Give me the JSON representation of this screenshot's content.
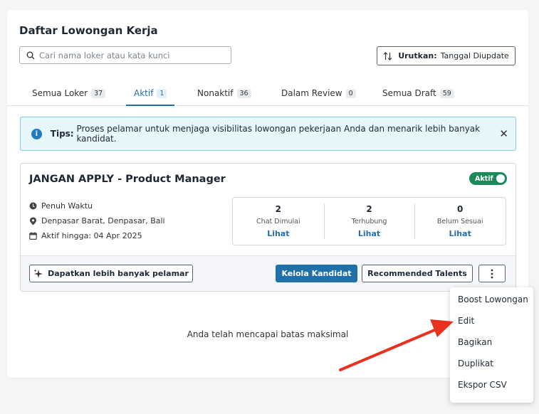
{
  "page": {
    "title": "Daftar Lowongan Kerja",
    "search_placeholder": "Cari nama loker atau kata kunci",
    "sort": {
      "label": "Urutkan:",
      "value": "Tanggal Diupdate"
    }
  },
  "tabs": [
    {
      "label": "Semua Loker",
      "count": "37"
    },
    {
      "label": "Aktif",
      "count": "1"
    },
    {
      "label": "Nonaktif",
      "count": "36"
    },
    {
      "label": "Dalam Review",
      "count": "0"
    },
    {
      "label": "Semua Draft",
      "count": "59"
    }
  ],
  "tips": {
    "label": "Tips:",
    "text": "Proses pelamar untuk menjaga visibilitas lowongan pekerjaan Anda dan menarik lebih banyak kandidat."
  },
  "job": {
    "title": "JANGAN APPLY - Product Manager",
    "status": "Aktif",
    "type": "Penuh Waktu",
    "location": "Denpasar Barat, Denpasar, Bali",
    "active_until_label": "Aktif hingga:",
    "active_until_value": "04 Apr 2025",
    "stats": [
      {
        "value": "2",
        "label": "Chat Dimulai",
        "link": "Lihat"
      },
      {
        "value": "2",
        "label": "Terhubung",
        "link": "Lihat"
      },
      {
        "value": "0",
        "label": "Belum Sesuai",
        "link": "Lihat"
      }
    ],
    "buttons": {
      "more_applicants": "Dapatkan lebih banyak pelamar",
      "manage": "Kelola Kandidat",
      "recommended": "Recommended Talents"
    }
  },
  "empty_message": "Anda telah mencapai batas maksimal",
  "menu": [
    "Boost Lowongan",
    "Edit",
    "Bagikan",
    "Duplikat",
    "Ekspor CSV"
  ],
  "colors": {
    "accent": "#1f6fa8",
    "active_badge": "#1b8a5a",
    "arrow": "#e8321f"
  }
}
